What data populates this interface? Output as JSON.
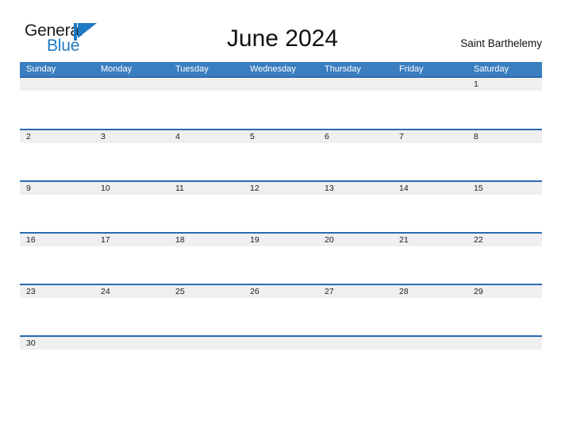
{
  "brand": {
    "name_part1": "General",
    "name_part2": "Blue",
    "flag_icon": "blue-triangle-flag-icon",
    "accent_color": "#2079c4"
  },
  "header": {
    "title": "June 2024",
    "month": "June",
    "year": "2024",
    "location": "Saint Barthelemy"
  },
  "theme": {
    "header_bar_color": "#3b7ec0",
    "row_rule_color": "#2a6cb0",
    "date_band_color": "#efefef",
    "page_background": "#ffffff"
  },
  "calendar": {
    "weekdays": [
      "Sunday",
      "Monday",
      "Tuesday",
      "Wednesday",
      "Thursday",
      "Friday",
      "Saturday"
    ],
    "weeks": [
      [
        "",
        "",
        "",
        "",
        "",
        "",
        "1"
      ],
      [
        "2",
        "3",
        "4",
        "5",
        "6",
        "7",
        "8"
      ],
      [
        "9",
        "10",
        "11",
        "12",
        "13",
        "14",
        "15"
      ],
      [
        "16",
        "17",
        "18",
        "19",
        "20",
        "21",
        "22"
      ],
      [
        "23",
        "24",
        "25",
        "26",
        "27",
        "28",
        "29"
      ],
      [
        "30",
        "",
        "",
        "",
        "",
        "",
        ""
      ]
    ]
  }
}
